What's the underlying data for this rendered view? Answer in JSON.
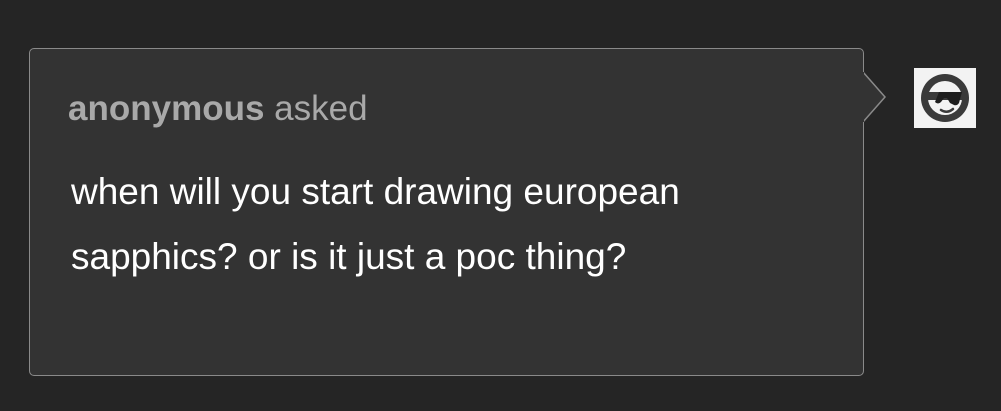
{
  "ask": {
    "asker_name": "anonymous",
    "asker_verb": "asked",
    "question": "when will you start drawing european sapphics? or is it just a poc thing?"
  },
  "avatar": {
    "icon": "sunglasses-face-icon"
  },
  "colors": {
    "page_background": "#252525",
    "bubble_background": "#333333",
    "bubble_border": "#8a8a8a",
    "asker_text": "#a9a9a9",
    "question_text": "#ffffff",
    "avatar_background": "#f3f3f3",
    "avatar_glyph": "#3a3a3a"
  }
}
